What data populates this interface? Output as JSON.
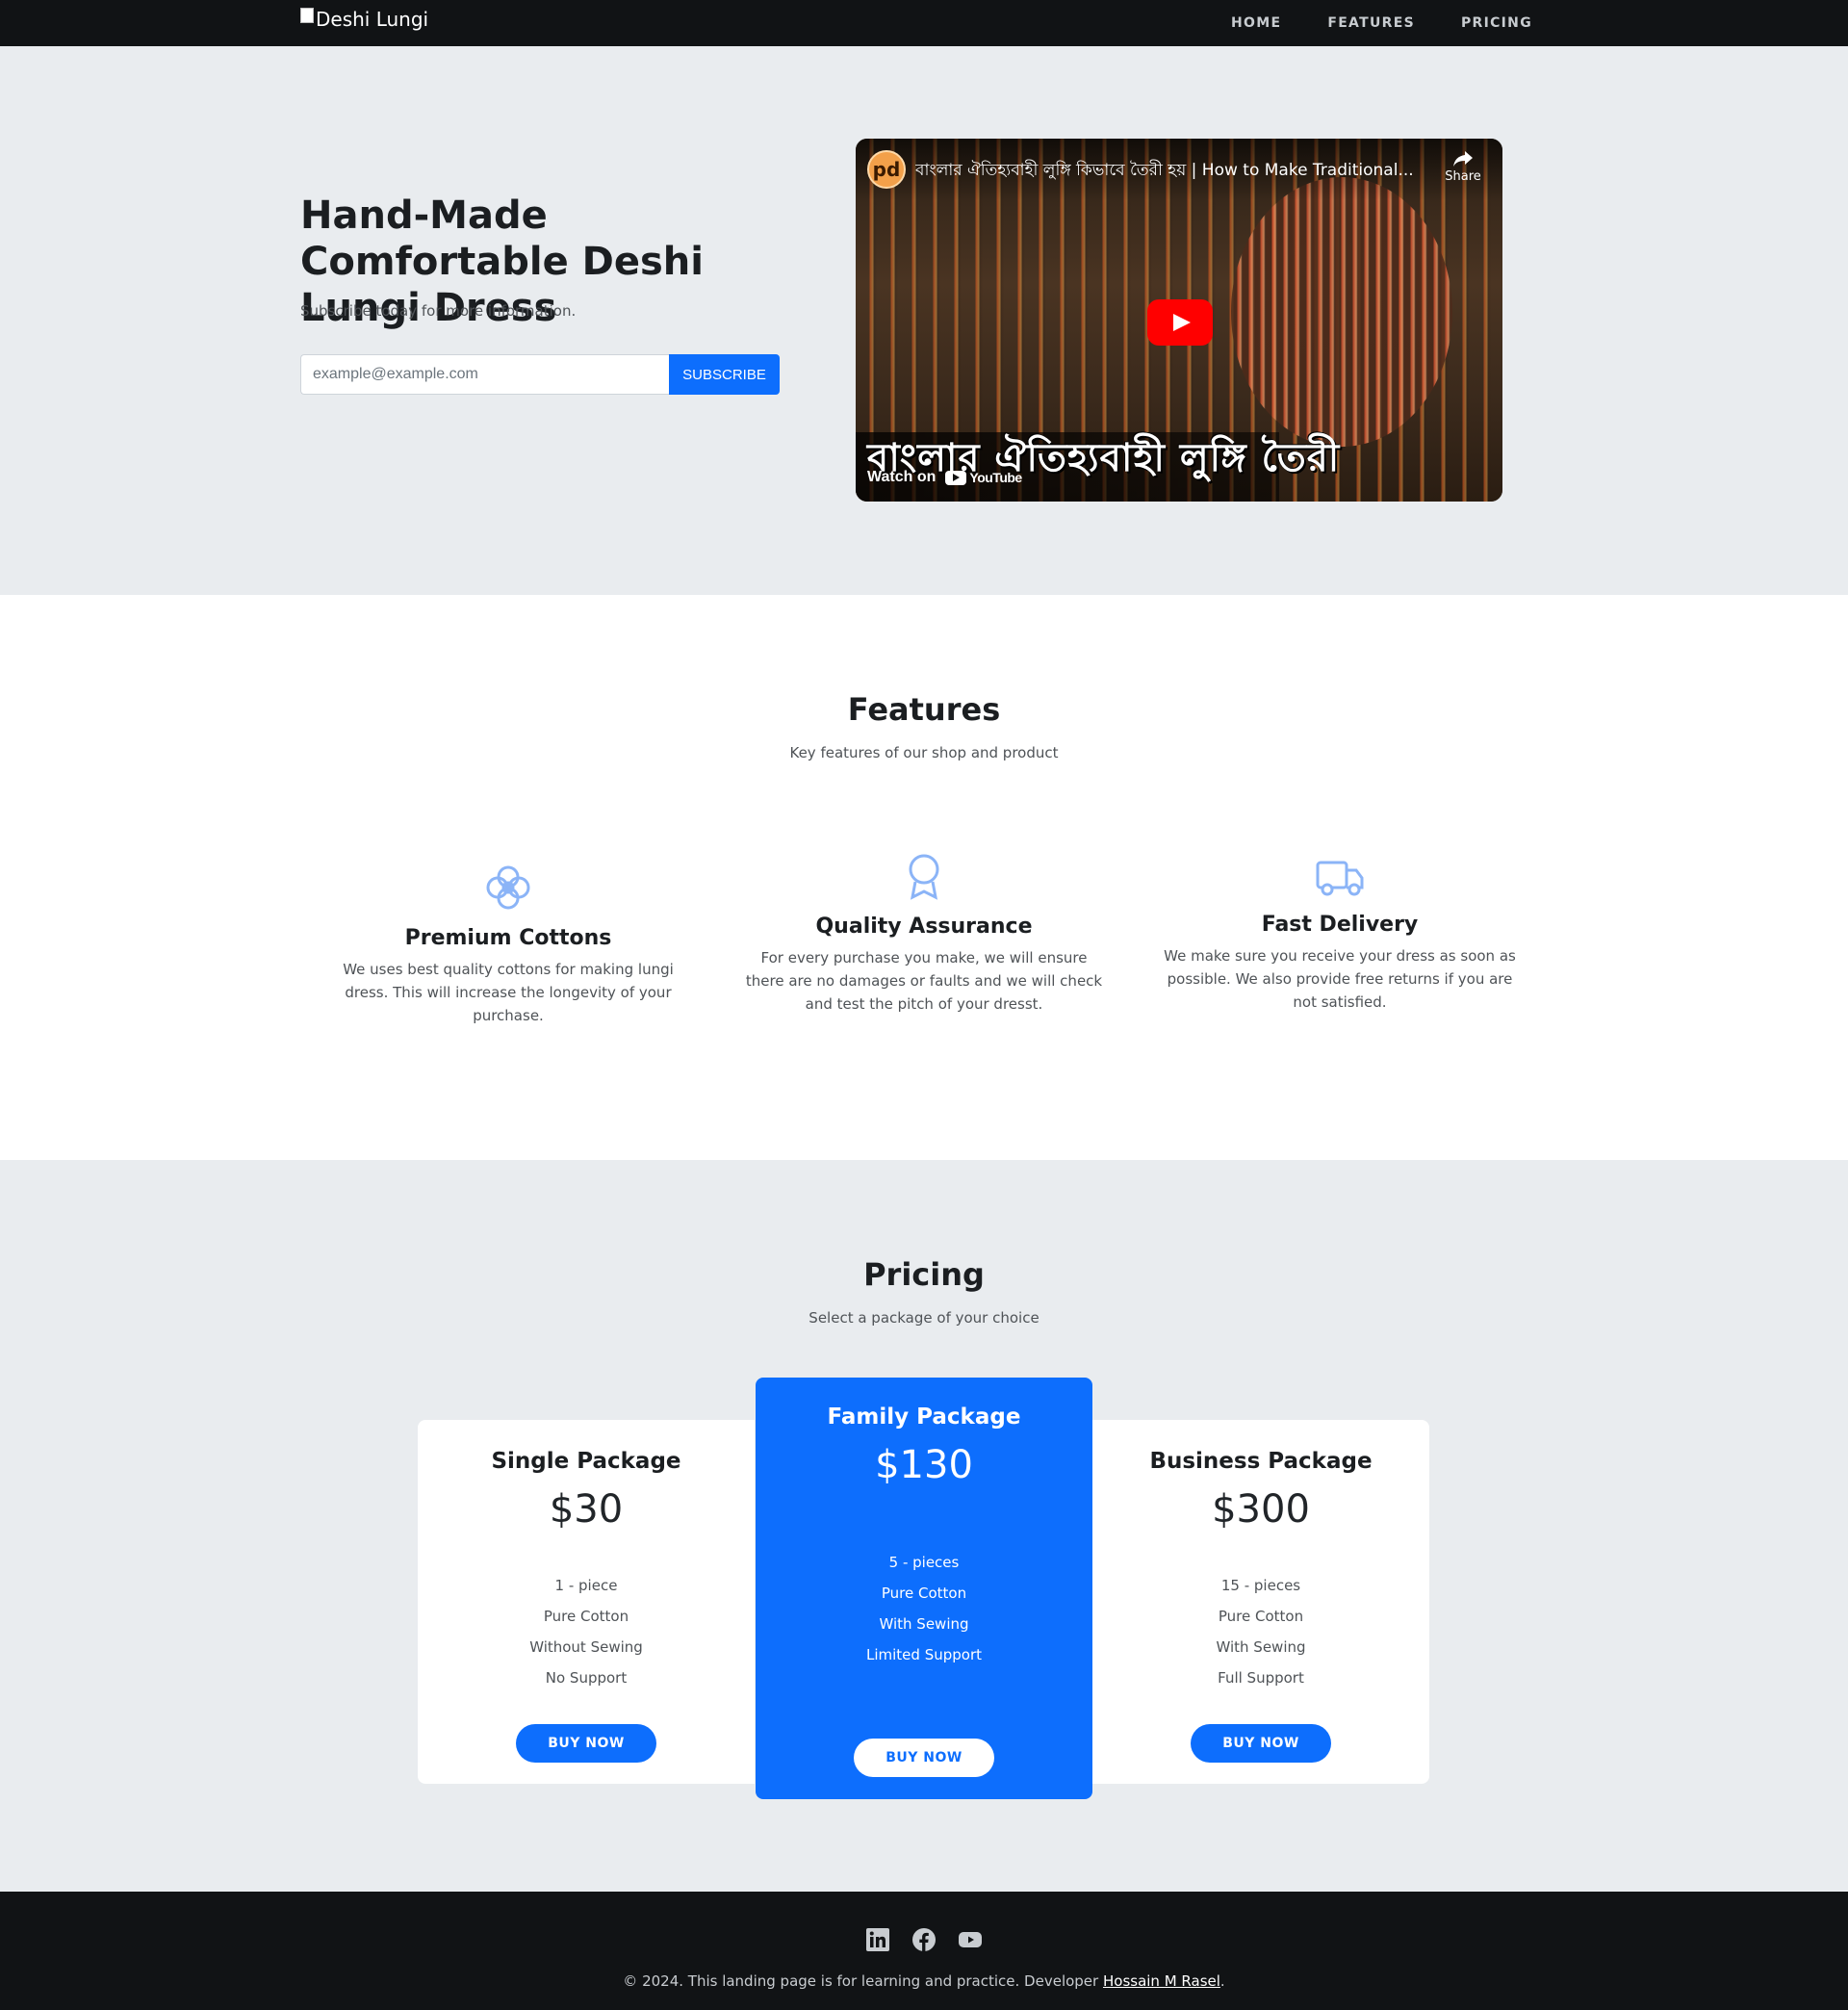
{
  "navbar": {
    "brand": "Deshi Lungi",
    "links": [
      "HOME",
      "FEATURES",
      "PRICING"
    ]
  },
  "hero": {
    "title": "Hand-Made Comfortable Deshi Lungi Dress",
    "subtitle": "Subscribe today for more information.",
    "email_placeholder": "example@example.com",
    "subscribe_label": "SUBSCRIBE",
    "video": {
      "channel_logo": "pd",
      "title": "বাংলার ঐতিহ্যবাহী লুঙ্গি কিভাবে তৈরী হয় | How to Make Traditional...",
      "share_label": "Share",
      "caption": "বাংলার ঐতিহ্যবাহী লুঙ্গি তৈরী",
      "watch_on": "Watch on",
      "youtube": "YouTube",
      "play_color": "#ff0000"
    }
  },
  "features": {
    "title": "Features",
    "subtitle": "Key features of our shop and product",
    "items": [
      {
        "icon": "flower-icon",
        "title": "Premium Cottons",
        "text": "We uses best quality cottons for making lungi dress. This will increase the longevity of your purchase."
      },
      {
        "icon": "award-icon",
        "title": "Quality Assurance",
        "text": "For every purchase you make, we will ensure there are no damages or faults and we will check and test the pitch of your dresst."
      },
      {
        "icon": "truck-icon",
        "title": "Fast Delivery",
        "text": "We make sure you receive your dress as soon as possible. We also provide free returns if you are not satisfied."
      }
    ]
  },
  "pricing": {
    "title": "Pricing",
    "subtitle": "Select a package of your choice",
    "packages": [
      {
        "name": "Single Package",
        "price": "$30",
        "features": [
          "1 - piece",
          "Pure Cotton",
          "Without Sewing",
          "No Support"
        ],
        "button": "BUY NOW"
      },
      {
        "name": "Family Package",
        "price": "$130",
        "features": [
          "5 - pieces",
          "Pure Cotton",
          "With Sewing",
          "Limited Support"
        ],
        "button": "BUY NOW"
      },
      {
        "name": "Business Package",
        "price": "$300",
        "features": [
          "15 - pieces",
          "Pure Cotton",
          "With Sewing",
          "Full Support"
        ],
        "button": "BUY NOW"
      }
    ]
  },
  "footer": {
    "social": [
      "linkedin-icon",
      "facebook-icon",
      "youtube-icon"
    ],
    "copyright": "© 2024. This landing page is for learning and practice. Developer ",
    "developer": "Hossain M Rasel",
    "period": "."
  },
  "colors": {
    "primary": "#0d6efd",
    "dark": "#111315",
    "light_bg": "#e9ecef",
    "icon": "#8bb4f7"
  }
}
